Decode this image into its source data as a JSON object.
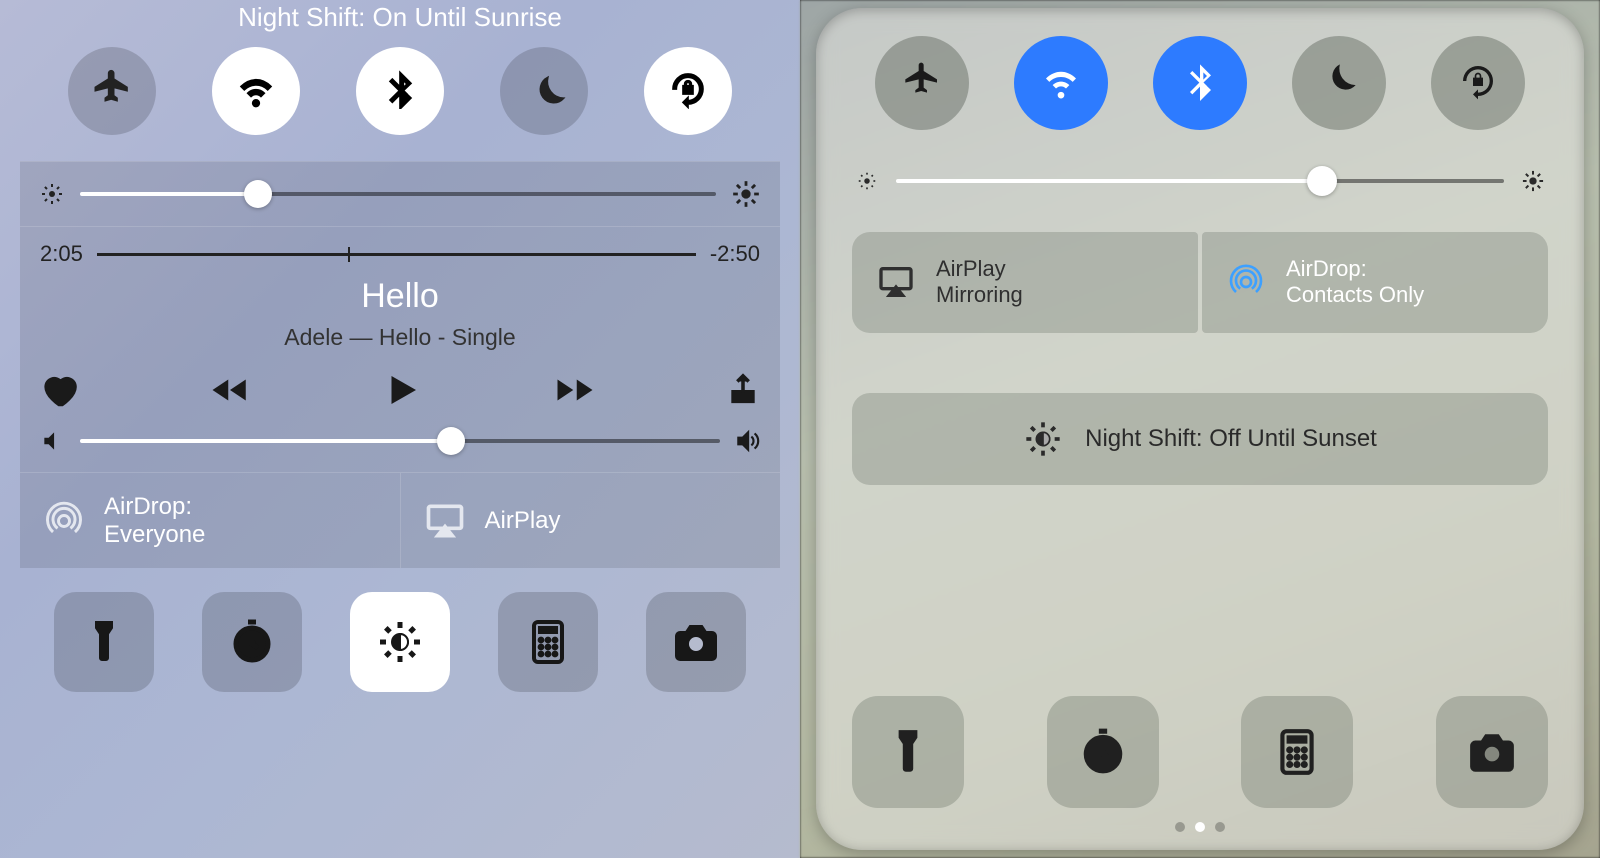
{
  "left": {
    "title": "Night Shift: On Until Sunrise",
    "toggles": {
      "airplane": {
        "name": "airplane-mode",
        "on": false
      },
      "wifi": {
        "name": "wifi",
        "on": true
      },
      "bluetooth": {
        "name": "bluetooth",
        "on": true
      },
      "dnd": {
        "name": "do-not-disturb",
        "on": false
      },
      "lock": {
        "name": "rotation-lock",
        "on": true
      }
    },
    "brightness_pct": 28,
    "media": {
      "elapsed": "2:05",
      "remaining": "-2:50",
      "title": "Hello",
      "subtitle": "Adele — Hello - Single",
      "volume_pct": 58
    },
    "air": {
      "airdrop_label": "AirDrop:\nEveryone",
      "airplay_label": "AirPlay"
    },
    "apps": {
      "flashlight": "flashlight",
      "timer": "timer",
      "nightshift": "night-shift",
      "calculator": "calculator",
      "camera": "camera"
    }
  },
  "right": {
    "toggles": {
      "airplane": {
        "name": "airplane-mode",
        "on": false
      },
      "wifi": {
        "name": "wifi",
        "on": true
      },
      "bluetooth": {
        "name": "bluetooth",
        "on": true
      },
      "dnd": {
        "name": "do-not-disturb",
        "on": false
      },
      "lock": {
        "name": "rotation-lock",
        "on": false
      }
    },
    "brightness_pct": 70,
    "air": {
      "airplay_label": "AirPlay\nMirroring",
      "airdrop_label": "AirDrop:\nContacts Only"
    },
    "night_shift_label": "Night Shift: Off Until Sunset",
    "apps": {
      "flashlight": "flashlight",
      "timer": "timer",
      "calculator": "calculator",
      "camera": "camera"
    },
    "page_dots": {
      "count": 3,
      "active": 1
    }
  }
}
